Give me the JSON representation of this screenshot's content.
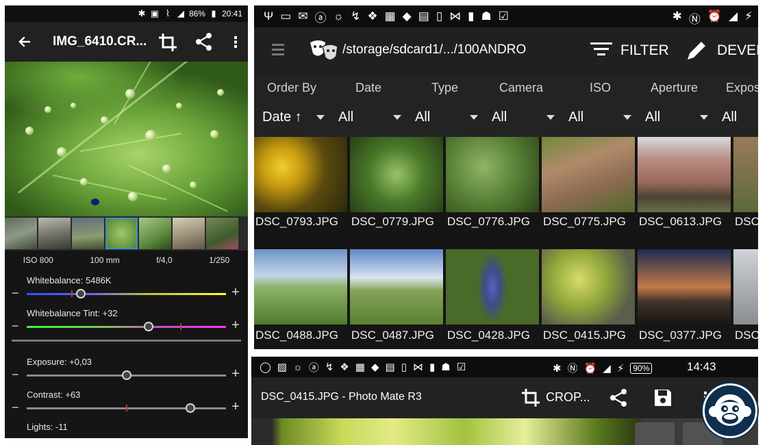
{
  "left_phone": {
    "status": {
      "battery_pct": "86%",
      "time": "20:41"
    },
    "toolbar": {
      "title": "IMG_6410.CR..."
    },
    "exif": [
      "ISO 800",
      "100 mm",
      "f/4,0",
      "1/250"
    ],
    "sliders": [
      {
        "label": "Whitebalance: 5486K",
        "value_frac": 0.27,
        "gradient": [
          "#3050ff",
          "#6060ff",
          "#c0c040",
          "#ffff33"
        ]
      },
      {
        "label": "Whitebalance Tint: +32",
        "value_frac": 0.61,
        "gradient": [
          "#33ff33",
          "#80c060",
          "#c050c0",
          "#ff33ff"
        ]
      },
      {
        "label": "Exposure: +0,03",
        "value_frac": 0.5,
        "gradient": []
      },
      {
        "label": "Contrast: +63",
        "value_frac": 0.82,
        "gradient": []
      },
      {
        "label": "Lights: -11",
        "value_frac": 0.46,
        "gradient": []
      }
    ],
    "icons": {
      "back": "arrow-left-icon",
      "crop": "crop-icon",
      "share": "share-icon",
      "more": "more-vert-icon"
    }
  },
  "right_top_phone": {
    "toolbar": {
      "path": "/storage/sdcard1/.../100ANDRO",
      "filter_label": "FILTER",
      "develop_label": "DEVEL"
    },
    "filters": {
      "headers": [
        "Order By",
        "Date",
        "Type",
        "Camera",
        "ISO",
        "Aperture",
        "Expos"
      ],
      "selections": [
        "Date ↑",
        "All",
        "All",
        "All",
        "All",
        "All",
        "All"
      ]
    },
    "grid": {
      "row1": [
        "DSC_0793.JPG",
        "DSC_0779.JPG",
        "DSC_0776.JPG",
        "DSC_0775.JPG",
        "DSC_0613.JPG",
        "DSC"
      ],
      "row2": [
        "DSC_0488.JPG",
        "DSC_0487.JPG",
        "DSC_0428.JPG",
        "DSC_0415.JPG",
        "DSC_0377.JPG",
        "DSC"
      ]
    }
  },
  "right_bottom_phone": {
    "status": {
      "battery_pct": "90%",
      "time": "14:43"
    },
    "toolbar": {
      "title": "DSC_0415.JPG - Photo Mate R3",
      "crop_label": "CROP..."
    }
  },
  "colors": {
    "toolbar_bg": "#212121",
    "selected_thumb_outline": "#3f8fd8",
    "badge_bg": "#0e2f4d"
  }
}
